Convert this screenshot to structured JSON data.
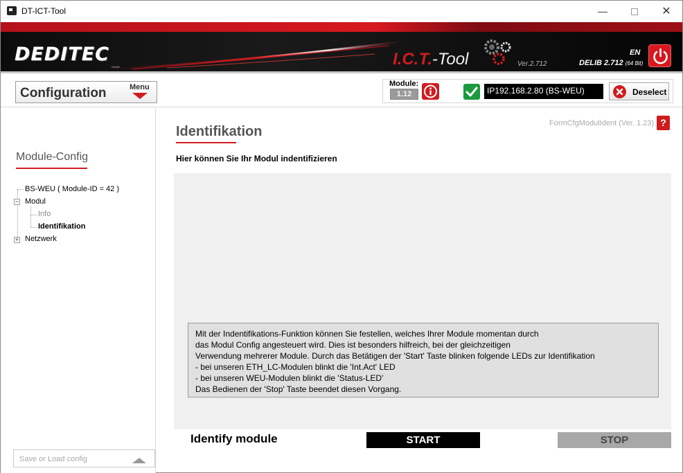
{
  "window": {
    "title": "DT-ICT-Tool",
    "minimize": "—",
    "close": "✕"
  },
  "banner": {
    "logo": "DEDITEC",
    "logo_sub": "GmbH",
    "app_name_red": "I.C.T.",
    "app_name_white": "-Tool",
    "version": "Ver.2.712",
    "delib": "DELIB 2.712",
    "delib_bits": "(64 Bit)",
    "language": "EN",
    "accent_color": "#d01c1f"
  },
  "configbar": {
    "title": "Configuration",
    "menu_label": "Menu",
    "module_label": "Module:",
    "module_version": "1.12",
    "ip_value": "IP192.168.2.80 (BS-WEU)",
    "deselect_label": "Deselect"
  },
  "sidebar": {
    "title": "Module-Config",
    "tree": {
      "root": "BS-WEU ( Module-ID = 42 )",
      "modul": "Modul",
      "info": "Info",
      "identifikation": "Identifikation",
      "netzwerk": "Netzwerk"
    },
    "save_placeholder": "Save or Load config"
  },
  "main": {
    "title": "Identifikation",
    "form_id": "FormCfgModulIdent (Ver. 1.23)",
    "help": "?",
    "subtitle": "Hier können Sie Ihr Modul indentifizieren",
    "info_lines": [
      "Mit der Indentifikations-Funktion können Sie festellen, welches Ihrer Module momentan durch",
      "das Modul Config angesteuert wird. Dies ist besonders hilfreich, bei der gleichzeitigen",
      "Verwendung mehrerer Module. Durch das Betätigen der 'Start' Taste blinken folgende LEDs zur Identifikation",
      "- bei unseren ETH_LC-Modulen blinkt die 'Int.Act' LED",
      "- bei unseren WEU-Modulen blinkt die 'Status-LED'",
      "Das Bedienen der 'Stop' Taste beendet diesen Vorgang."
    ],
    "identify_label": "Identify module",
    "start_label": "START",
    "stop_label": "STOP"
  }
}
